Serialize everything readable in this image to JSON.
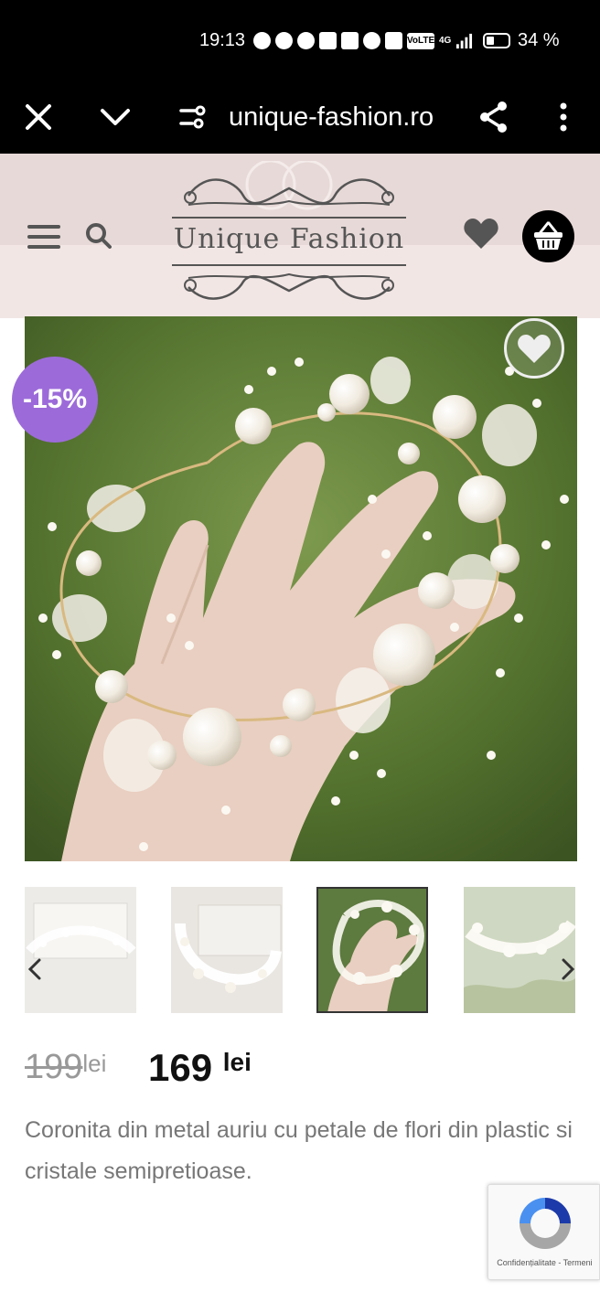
{
  "status_bar": {
    "time": "19:13",
    "battery": "34 %",
    "volte_label": "VoLTE",
    "network": "4G"
  },
  "browser": {
    "url": "unique-fashion.ro"
  },
  "site": {
    "logo_text": "Unique Fashion"
  },
  "product": {
    "discount": "-15%",
    "old_price": "199",
    "old_currency": "lei",
    "new_price": "169",
    "new_currency": "lei",
    "description": "Coronita din metal auriu cu petale de flori din plastic si cristale semipretioase.",
    "thumbnail_count": 4,
    "selected_thumbnail": 3
  },
  "recaptcha": {
    "links": "Confidențialitate - Termeni"
  },
  "colors": {
    "header_bg": "#e7d9d7",
    "badge": "#9c6bd9",
    "cart_bg": "#000000"
  }
}
